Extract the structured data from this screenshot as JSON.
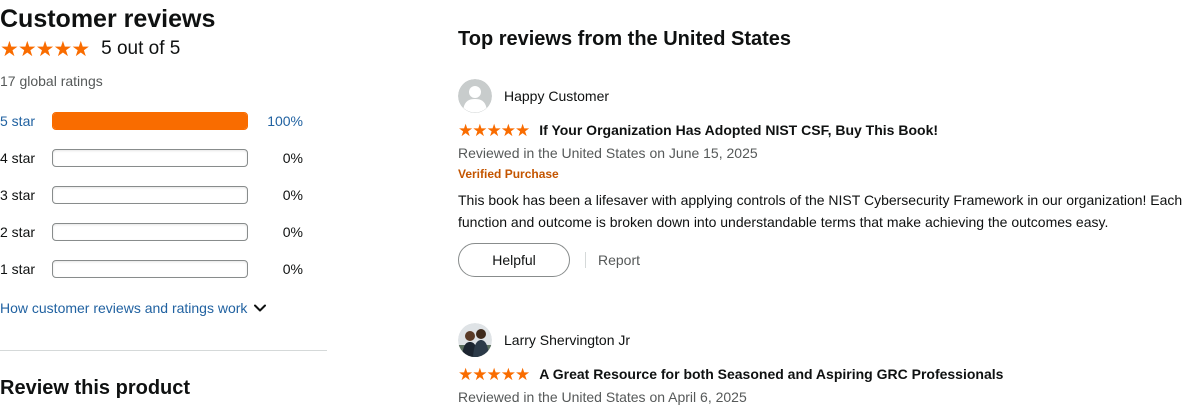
{
  "summary": {
    "title": "Customer reviews",
    "rating_value": 5,
    "rating_text": "5 out of 5",
    "global_ratings": "17 global ratings",
    "histogram": [
      {
        "label": "5 star",
        "percent_text": "100%",
        "fraction": 1.0
      },
      {
        "label": "4 star",
        "percent_text": "0%",
        "fraction": 0
      },
      {
        "label": "3 star",
        "percent_text": "0%",
        "fraction": 0
      },
      {
        "label": "2 star",
        "percent_text": "0%",
        "fraction": 0
      },
      {
        "label": "1 star",
        "percent_text": "0%",
        "fraction": 0
      }
    ],
    "how_link": "How customer reviews and ratings work",
    "review_product_heading": "Review this product"
  },
  "reviews_section": {
    "title": "Top reviews from the United States",
    "reviews": [
      {
        "reviewer": "Happy Customer",
        "rating": 5,
        "title": "If Your Organization Has Adopted NIST CSF, Buy This Book!",
        "date": "Reviewed in the United States on June 15, 2025",
        "verified": "Verified Purchase",
        "body": "This book has been a lifesaver with applying controls of the NIST Cybersecurity Framework in our organization! Each function and outcome is broken down into understandable terms that make achieving the outcomes easy.",
        "helpful_label": "Helpful",
        "report_label": "Report"
      },
      {
        "reviewer": "Larry Shervington Jr",
        "rating": 5,
        "title": "A Great Resource for both Seasoned and Aspiring GRC Professionals",
        "date": "Reviewed in the United States on April 6, 2025"
      }
    ]
  },
  "colors": {
    "star": "#f96c00",
    "link": "#2162a1",
    "verified": "#c45500"
  }
}
